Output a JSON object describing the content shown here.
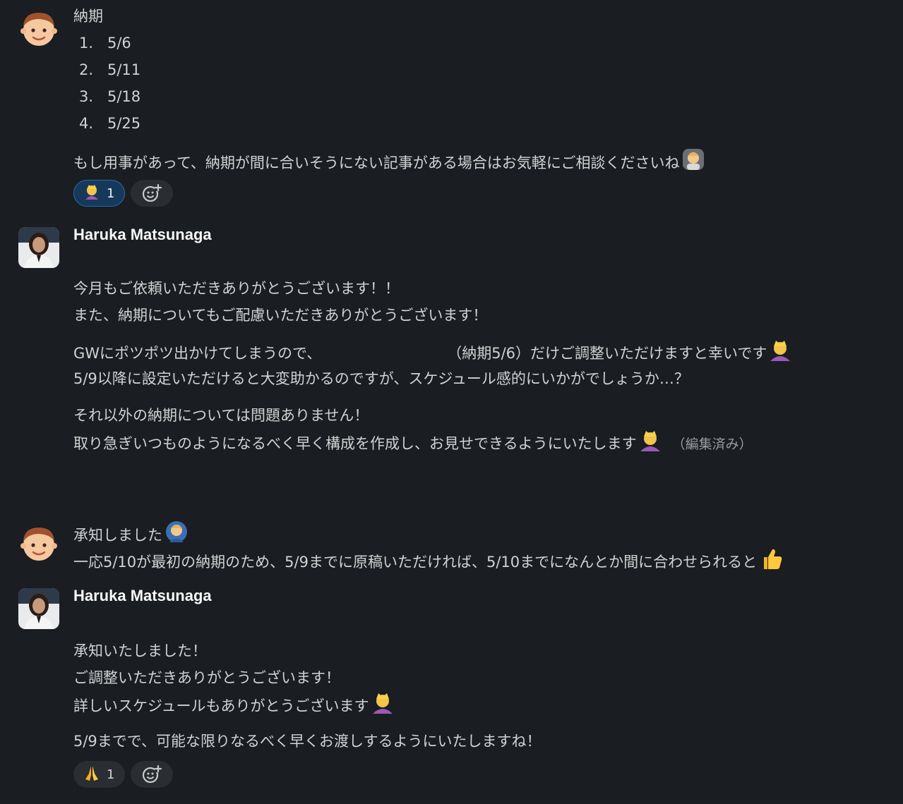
{
  "messages": {
    "m1": {
      "title_line": "納期",
      "dates": [
        {
          "num": "1.",
          "date": "5/6"
        },
        {
          "num": "2.",
          "date": "5/11"
        },
        {
          "num": "3.",
          "date": "5/18"
        },
        {
          "num": "4.",
          "date": "5/25"
        }
      ],
      "closing": "もし用事があって、納期が間に合いそうにない記事がある場合はお気軽にご相談くださいね",
      "closing_emoji": "person-gesturing-ok-icon",
      "reaction": {
        "emoji": "person-bowing-icon",
        "count": "1"
      }
    },
    "m2": {
      "author": "Haruka Matsunaga",
      "lines_a": [
        "今月もご依頼いただきありがとうございます！！",
        "また、納期についてもご配慮いただきありがとうございます！"
      ],
      "line_b1_pre": "GWにポツポツ出かけてしまうので、",
      "line_b1_post": "（納期5/6）だけご調整いただけますと幸いです",
      "line_b2": "5/9以降に設定いただけると大変助かるのですが、スケジュール感的にいかがでしょうか…？",
      "line_c1": "それ以外の納期については問題ありません！",
      "line_c2": "取り急ぎいつものようになるべく早く構成を作成し、お見せできるようにいたします",
      "edited_label": "（編集済み）"
    },
    "m3": {
      "line1": "承知しました",
      "line2": "一応5/10が最初の納期のため、5/9までに原稿いただければ、5/10までになんとか間に合わせられると"
    },
    "m4": {
      "author": "Haruka Matsunaga",
      "lines": [
        "承知いたしました！",
        "ご調整いただきありがとうございます！",
        "詳しいスケジュールもありがとうございます"
      ],
      "final": "5/9までで、可能な限りなるべく早くお渡しするようにいたしますね！",
      "reaction": {
        "emoji": "folded-hands-icon",
        "count": "1"
      }
    }
  },
  "colors": {
    "background": "#1a1d21",
    "text": "#d1d2d3",
    "reaction_active_bg": "#16395a",
    "reaction_active_border": "#1d6fb8"
  }
}
